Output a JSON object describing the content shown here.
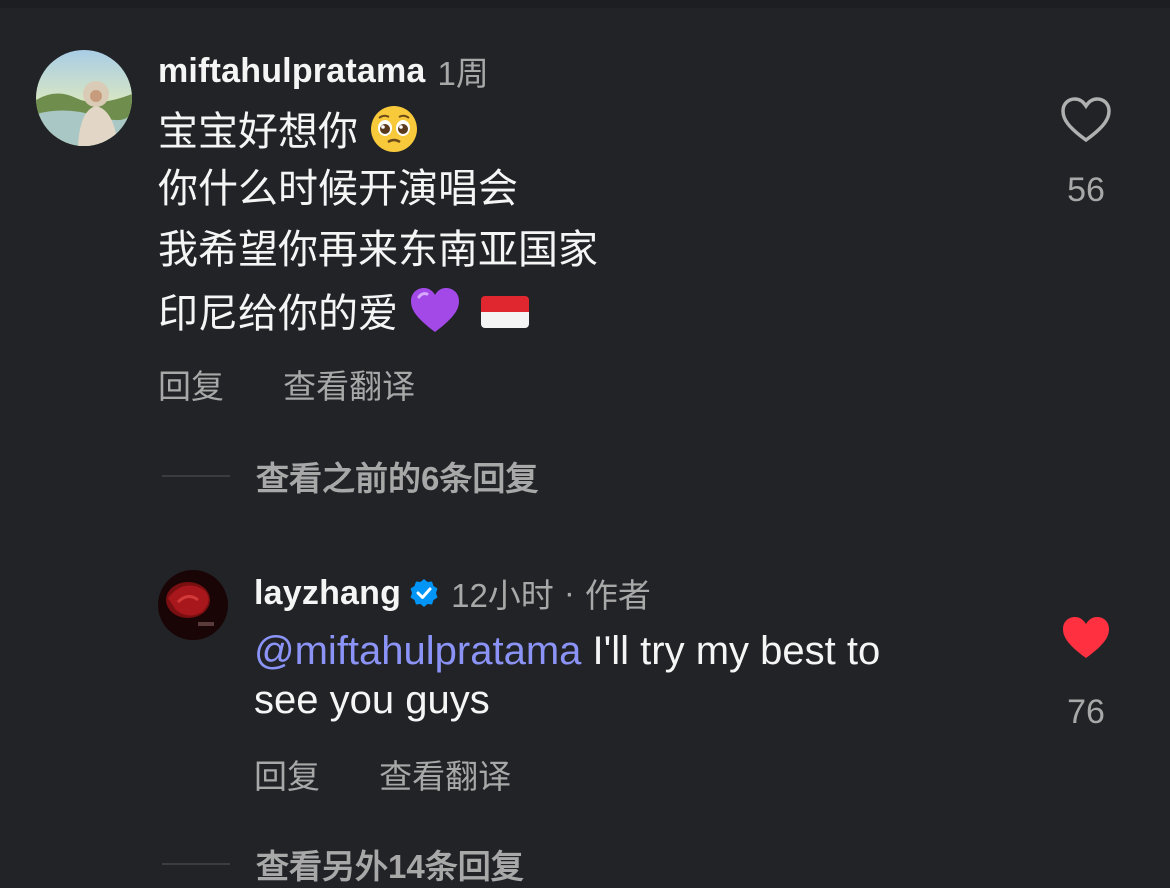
{
  "comments": [
    {
      "username": "miftahulpratama",
      "time": "1周",
      "lines": [
        "宝宝好想你",
        "你什么时候开演唱会",
        "我希望你再来东南亚国家",
        "印尼给你的爱"
      ],
      "like_count": "56",
      "liked": false,
      "reply_label": "回复",
      "translate_label": "查看翻译",
      "view_previous_replies": "查看之前的6条回复"
    },
    {
      "username": "layzhang",
      "verified": true,
      "time": "12小时",
      "dot": "·",
      "author_badge": "作者",
      "mention": "@miftahulpratama",
      "text_line1": " I'll try my best to",
      "text_line2": "see you guys",
      "like_count": "76",
      "liked": true,
      "reply_label": "回复",
      "translate_label": "查看翻译",
      "view_more_replies": "查看另外14条回复"
    }
  ],
  "colors": {
    "background": "#212327",
    "secondary_text": "#a8a8a8",
    "mention": "#8b94f6",
    "liked_heart": "#ff3040",
    "verified_badge": "#0095f6"
  },
  "icons": {
    "pleading_face": "pleading-face-emoji",
    "purple_heart": "purple-heart-emoji",
    "flag": "indonesia-flag-emoji"
  }
}
